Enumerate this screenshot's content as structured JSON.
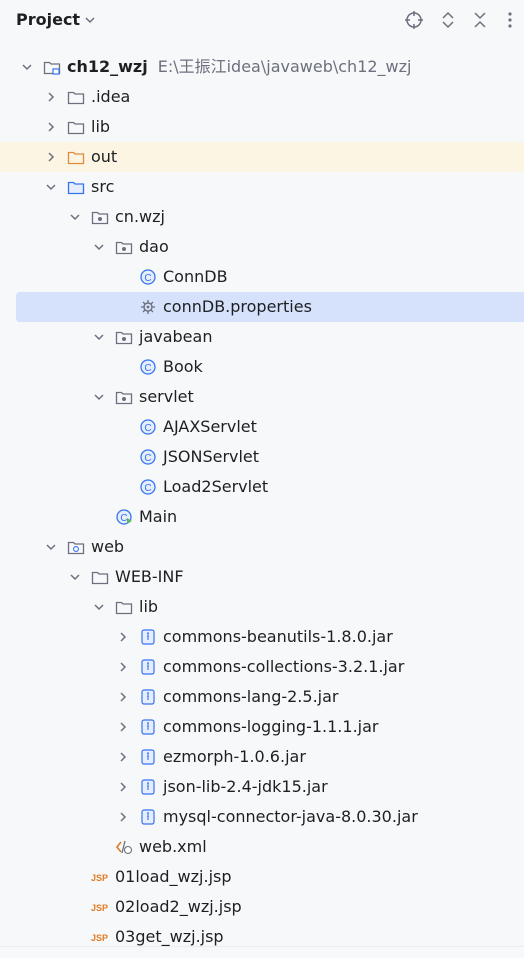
{
  "header": {
    "title": "Project"
  },
  "tree": [
    {
      "label": "ch12_wzj",
      "path": "E:\\王振江idea\\javaweb\\ch12_wzj",
      "depth": 0,
      "arrow": "down",
      "icon": "module-folder",
      "bold": true
    },
    {
      "label": ".idea",
      "depth": 1,
      "arrow": "right",
      "icon": "folder"
    },
    {
      "label": "lib",
      "depth": 1,
      "arrow": "right",
      "icon": "folder"
    },
    {
      "label": "out",
      "depth": 1,
      "arrow": "right",
      "icon": "folder-orange",
      "highlight": "excluded"
    },
    {
      "label": "src",
      "depth": 1,
      "arrow": "down",
      "icon": "source-folder"
    },
    {
      "label": "cn.wzj",
      "depth": 2,
      "arrow": "down",
      "icon": "package"
    },
    {
      "label": "dao",
      "depth": 3,
      "arrow": "down",
      "icon": "package"
    },
    {
      "label": "ConnDB",
      "depth": 4,
      "arrow": "none",
      "icon": "class"
    },
    {
      "label": "connDB.properties",
      "depth": 4,
      "arrow": "none",
      "icon": "properties",
      "selected": true
    },
    {
      "label": "javabean",
      "depth": 3,
      "arrow": "down",
      "icon": "package"
    },
    {
      "label": "Book",
      "depth": 4,
      "arrow": "none",
      "icon": "class"
    },
    {
      "label": "servlet",
      "depth": 3,
      "arrow": "down",
      "icon": "package"
    },
    {
      "label": "AJAXServlet",
      "depth": 4,
      "arrow": "none",
      "icon": "class"
    },
    {
      "label": "JSONServlet",
      "depth": 4,
      "arrow": "none",
      "icon": "class"
    },
    {
      "label": "Load2Servlet",
      "depth": 4,
      "arrow": "none",
      "icon": "class"
    },
    {
      "label": "Main",
      "depth": 3,
      "arrow": "none",
      "icon": "main-class"
    },
    {
      "label": "web",
      "depth": 1,
      "arrow": "down",
      "icon": "web-folder"
    },
    {
      "label": "WEB-INF",
      "depth": 2,
      "arrow": "down",
      "icon": "folder"
    },
    {
      "label": "lib",
      "depth": 3,
      "arrow": "down",
      "icon": "folder"
    },
    {
      "label": "commons-beanutils-1.8.0.jar",
      "depth": 4,
      "arrow": "right",
      "icon": "jar"
    },
    {
      "label": "commons-collections-3.2.1.jar",
      "depth": 4,
      "arrow": "right",
      "icon": "jar"
    },
    {
      "label": "commons-lang-2.5.jar",
      "depth": 4,
      "arrow": "right",
      "icon": "jar"
    },
    {
      "label": "commons-logging-1.1.1.jar",
      "depth": 4,
      "arrow": "right",
      "icon": "jar"
    },
    {
      "label": "ezmorph-1.0.6.jar",
      "depth": 4,
      "arrow": "right",
      "icon": "jar"
    },
    {
      "label": "json-lib-2.4-jdk15.jar",
      "depth": 4,
      "arrow": "right",
      "icon": "jar"
    },
    {
      "label": "mysql-connector-java-8.0.30.jar",
      "depth": 4,
      "arrow": "right",
      "icon": "jar"
    },
    {
      "label": "web.xml",
      "depth": 3,
      "arrow": "none",
      "icon": "xml"
    },
    {
      "label": "01load_wzj.jsp",
      "depth": 2,
      "arrow": "none",
      "icon": "jsp"
    },
    {
      "label": "02load2_wzj.jsp",
      "depth": 2,
      "arrow": "none",
      "icon": "jsp"
    },
    {
      "label": "03get_wzj.jsp",
      "depth": 2,
      "arrow": "none",
      "icon": "jsp"
    }
  ],
  "colors": {
    "background": "#f7f8fa",
    "selected": "#d6e2fb",
    "excluded": "#fdf5e3",
    "class_icon": "#3574f0",
    "jsp_icon": "#e07b24",
    "folder_orange": "#e08b3a"
  }
}
